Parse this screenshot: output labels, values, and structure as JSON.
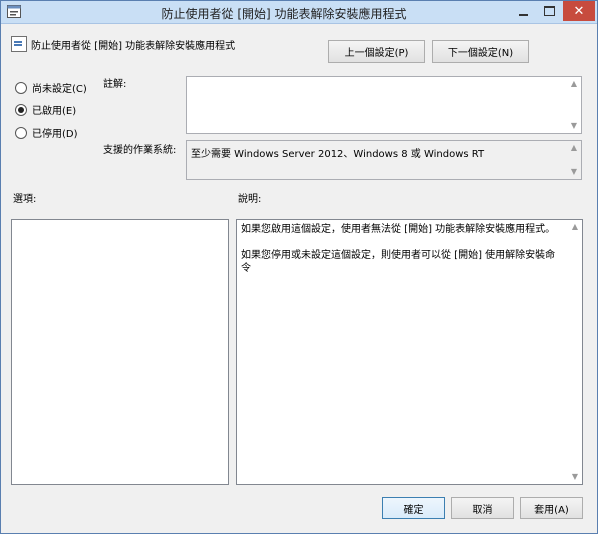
{
  "window": {
    "title": "防止使用者從 [開始] 功能表解除安裝應用程式",
    "close_glyph": "✕"
  },
  "header": {
    "policy_name": "防止使用者從 [開始] 功能表解除安裝應用程式",
    "prev_button": "上一個設定(P)",
    "next_button": "下一個設定(N)"
  },
  "state": {
    "options": [
      {
        "label": "尚未設定(C)",
        "selected": false
      },
      {
        "label": "已啟用(E)",
        "selected": true
      },
      {
        "label": "已停用(D)",
        "selected": false
      }
    ]
  },
  "comment": {
    "label": "註解:",
    "value": ""
  },
  "supported": {
    "label": "支援的作業系統:",
    "value": "至少需要 Windows Server 2012、Windows 8 或 Windows RT"
  },
  "panels": {
    "options_label": "選項:",
    "help_label": "說明:",
    "help_paragraphs": [
      "如果您啟用這個設定，使用者無法從 [開始] 功能表解除安裝應用程式。",
      "如果您停用或未設定這個設定，則使用者可以從 [開始] 使用解除安裝命令"
    ]
  },
  "footer": {
    "ok": "確定",
    "cancel": "取消",
    "apply": "套用(A)"
  }
}
